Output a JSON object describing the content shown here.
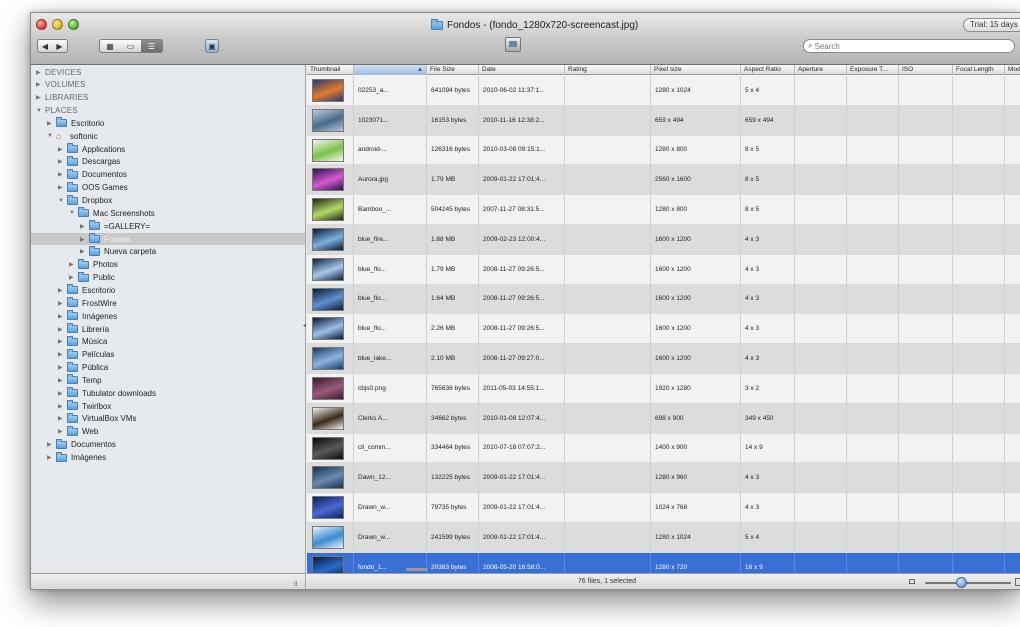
{
  "window": {
    "title": "Fondos - (fondo_1280x720-screencast.jpg)",
    "trial_badge": "Trial: 15 days"
  },
  "toolbar": {
    "back_icon": "chevron-left-icon",
    "forward_icon": "chevron-right-icon",
    "view_grid_icon": "grid-view-icon",
    "view_cover_icon": "coverflow-view-icon",
    "view_list_icon": "list-view-icon",
    "search_placeholder": "Search"
  },
  "sidebar": {
    "items": [
      {
        "label": "DEVICES",
        "indent": 0,
        "disclosure": "closed",
        "kind": "header"
      },
      {
        "label": "VOLUMES",
        "indent": 0,
        "disclosure": "closed",
        "kind": "header"
      },
      {
        "label": "LIBRARIES",
        "indent": 0,
        "disclosure": "closed",
        "kind": "header"
      },
      {
        "label": "PLACES",
        "indent": 0,
        "disclosure": "open",
        "kind": "header"
      },
      {
        "label": "Escritorio",
        "indent": 1,
        "disclosure": "closed",
        "kind": "folder"
      },
      {
        "label": "softonic",
        "indent": 1,
        "disclosure": "open",
        "kind": "home"
      },
      {
        "label": "Applications",
        "indent": 2,
        "disclosure": "closed",
        "kind": "folder"
      },
      {
        "label": "Descargas",
        "indent": 2,
        "disclosure": "closed",
        "kind": "folder"
      },
      {
        "label": "Documentos",
        "indent": 2,
        "disclosure": "closed",
        "kind": "folder"
      },
      {
        "label": "OOS Games",
        "indent": 2,
        "disclosure": "closed",
        "kind": "folder"
      },
      {
        "label": "Dropbox",
        "indent": 2,
        "disclosure": "open",
        "kind": "folder"
      },
      {
        "label": "Mac Screenshots",
        "indent": 3,
        "disclosure": "open",
        "kind": "folder"
      },
      {
        "label": "=GALLERY=",
        "indent": 4,
        "disclosure": "closed",
        "kind": "folder"
      },
      {
        "label": "Fondos",
        "indent": 4,
        "disclosure": "closed",
        "kind": "folder",
        "selected": true
      },
      {
        "label": "Nueva carpeta",
        "indent": 4,
        "disclosure": "closed",
        "kind": "folder"
      },
      {
        "label": "Photos",
        "indent": 3,
        "disclosure": "closed",
        "kind": "folder"
      },
      {
        "label": "Public",
        "indent": 3,
        "disclosure": "closed",
        "kind": "folder"
      },
      {
        "label": "Escritorio",
        "indent": 2,
        "disclosure": "closed",
        "kind": "folder"
      },
      {
        "label": "FrostWire",
        "indent": 2,
        "disclosure": "closed",
        "kind": "folder"
      },
      {
        "label": "Imágenes",
        "indent": 2,
        "disclosure": "closed",
        "kind": "folder"
      },
      {
        "label": "Librería",
        "indent": 2,
        "disclosure": "closed",
        "kind": "folder"
      },
      {
        "label": "Música",
        "indent": 2,
        "disclosure": "closed",
        "kind": "folder"
      },
      {
        "label": "Películas",
        "indent": 2,
        "disclosure": "closed",
        "kind": "folder"
      },
      {
        "label": "Pública",
        "indent": 2,
        "disclosure": "closed",
        "kind": "folder"
      },
      {
        "label": "Temp",
        "indent": 2,
        "disclosure": "closed",
        "kind": "folder"
      },
      {
        "label": "Tubulator downloads",
        "indent": 2,
        "disclosure": "closed",
        "kind": "folder"
      },
      {
        "label": "Twirlbox",
        "indent": 2,
        "disclosure": "closed",
        "kind": "folder"
      },
      {
        "label": "VirtualBox VMs",
        "indent": 2,
        "disclosure": "closed",
        "kind": "folder"
      },
      {
        "label": "Web",
        "indent": 2,
        "disclosure": "closed",
        "kind": "folder"
      },
      {
        "label": "Documentos",
        "indent": 1,
        "disclosure": "closed",
        "kind": "folder"
      },
      {
        "label": "Imágenes",
        "indent": 1,
        "disclosure": "closed",
        "kind": "folder"
      }
    ]
  },
  "table": {
    "columns": [
      {
        "key": "thumbnail",
        "label": "Thumbnail"
      },
      {
        "key": "name",
        "label": ""
      },
      {
        "key": "size",
        "label": "File Size"
      },
      {
        "key": "date",
        "label": "Date"
      },
      {
        "key": "rating",
        "label": "Rating"
      },
      {
        "key": "pixel",
        "label": "Pixel size"
      },
      {
        "key": "aspect",
        "label": "Aspect Ratio"
      },
      {
        "key": "aperture",
        "label": "Aperture"
      },
      {
        "key": "exposure",
        "label": "Exposure T..."
      },
      {
        "key": "iso",
        "label": "ISO"
      },
      {
        "key": "focal",
        "label": "Focal Length"
      },
      {
        "key": "model",
        "label": "Model"
      }
    ],
    "rows": [
      {
        "name": "02253_a...",
        "size": "641094 bytes",
        "date": "2010-06-02 11:37:1...",
        "pixel": "1280 x 1024",
        "aspect": "5 x 4",
        "thumb": [
          "#2a3b6e",
          "#e07a2e"
        ]
      },
      {
        "name": "1023071...",
        "size": "16153 bytes",
        "date": "2010-11-16 12:38:2...",
        "pixel": "659 x 494",
        "aspect": "659 x 494",
        "thumb": [
          "#b8c9da",
          "#4a6a8a"
        ]
      },
      {
        "name": "android-...",
        "size": "126316 bytes",
        "date": "2010-03-08 09:15:1...",
        "pixel": "1280 x 800",
        "aspect": "8 x 5",
        "thumb": [
          "#f4f4f4",
          "#7cc24a"
        ]
      },
      {
        "name": "Aurora.jpg",
        "size": "1.79 MB",
        "date": "2009-01-22 17:01:4...",
        "pixel": "2560 x 1600",
        "aspect": "8 x 5",
        "thumb": [
          "#2a1450",
          "#d45ad0"
        ]
      },
      {
        "name": "Bamboo_...",
        "size": "504245 bytes",
        "date": "2007-11-27 08:31:5...",
        "pixel": "1280 x 800",
        "aspect": "8 x 5",
        "thumb": [
          "#1c2a10",
          "#b6d86a"
        ]
      },
      {
        "name": "blue_fire...",
        "size": "1.88 MB",
        "date": "2009-02-23 12:00:4...",
        "pixel": "1600 x 1200",
        "aspect": "4 x 3",
        "thumb": [
          "#0a1830",
          "#7fb0e0"
        ]
      },
      {
        "name": "blue_flo...",
        "size": "1.79 MB",
        "date": "2008-11-27 09:26:5...",
        "pixel": "1600 x 1200",
        "aspect": "4 x 3",
        "thumb": [
          "#10203a",
          "#a8c8ec"
        ]
      },
      {
        "name": "blue_flo...",
        "size": "1.64 MB",
        "date": "2008-11-27 09:26:5...",
        "pixel": "1600 x 1200",
        "aspect": "4 x 3",
        "thumb": [
          "#0c1a34",
          "#5f8fcf"
        ]
      },
      {
        "name": "blue_flo...",
        "size": "2.26 MB",
        "date": "2008-11-27 09:26:5...",
        "pixel": "1600 x 1200",
        "aspect": "4 x 3",
        "thumb": [
          "#0a1630",
          "#9cc0ea"
        ]
      },
      {
        "name": "blue_lake...",
        "size": "2.10 MB",
        "date": "2008-11-27 09:27:0...",
        "pixel": "1600 x 1200",
        "aspect": "4 x 3",
        "thumb": [
          "#1a3a6a",
          "#8ab4dc"
        ]
      },
      {
        "name": "cbjs0.png",
        "size": "765636 bytes",
        "date": "2011-05-03 14:55:1...",
        "pixel": "1920 x 1280",
        "aspect": "3 x 2",
        "thumb": [
          "#3a1a2a",
          "#9a5a7a"
        ]
      },
      {
        "name": "Clerks A...",
        "size": "34662 bytes",
        "date": "2010-01-08 12:07:4...",
        "pixel": "698 x 900",
        "aspect": "349 x 450",
        "thumb": [
          "#f0f0f0",
          "#3a2a18"
        ]
      },
      {
        "name": "cli_comm...",
        "size": "334464 bytes",
        "date": "2010-07-18 07:07:2...",
        "pixel": "1400 x 900",
        "aspect": "14 x 9",
        "thumb": [
          "#0c0c0c",
          "#5a5a5a"
        ]
      },
      {
        "name": "Dawn_12...",
        "size": "132225 bytes",
        "date": "2009-01-22 17:01:4...",
        "pixel": "1280 x 960",
        "aspect": "4 x 3",
        "thumb": [
          "#1a3050",
          "#6a8ab0"
        ]
      },
      {
        "name": "Drawn_w...",
        "size": "79735 bytes",
        "date": "2009-01-22 17:01:4...",
        "pixel": "1024 x 768",
        "aspect": "4 x 3",
        "thumb": [
          "#0e1e5a",
          "#4a6ad0"
        ]
      },
      {
        "name": "Drawn_w...",
        "size": "241599 bytes",
        "date": "2009-01-22 17:01:4...",
        "pixel": "1280 x 1024",
        "aspect": "5 x 4",
        "thumb": [
          "#e8f0fa",
          "#3a8ad0"
        ]
      },
      {
        "name": "fondo_1...",
        "size": "20383 bytes",
        "date": "2008-05-20 16:58:0...",
        "pixel": "1280 x 720",
        "aspect": "16 x 9",
        "thumb": [
          "#0a1a40",
          "#2a6ac8"
        ],
        "selected": true
      }
    ]
  },
  "status": {
    "text": "76 files, 1 selected"
  },
  "zoom": {
    "small_icon": "zoom-small-icon",
    "large_icon": "zoom-large-icon",
    "level": 0.45
  },
  "colors": {
    "selection": "#3a6fd6",
    "sidebar_bg": "#e6eaef"
  }
}
